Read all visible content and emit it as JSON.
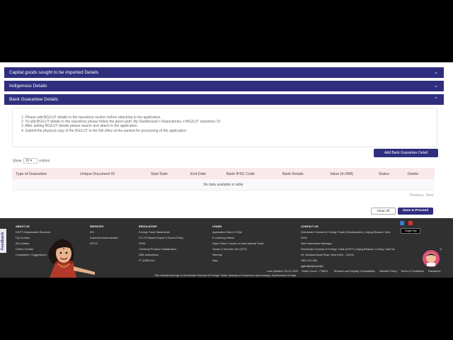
{
  "sections": [
    {
      "title": "Capital goods sought to be imported Details",
      "chevron": "⌄"
    },
    {
      "title": "Indigenous Details",
      "chevron": "⌄"
    },
    {
      "title": "Bank Guarantee Details",
      "chevron": "⌃"
    }
  ],
  "instructions": [
    "1. Please add BG/LUT details in the repository section before attaching to the application.",
    "2. To add BG/LUT details in the repository please follow the given path: My Dashboard>> Repositories >>BG/LUT repository Or",
    "3. After adding BG/LUT details please search and attach in the application.",
    "4. Submit the physical copy of the BG/LUT to the RA office at the earliest for processing of the application."
  ],
  "add_button": "Add Bank Guarantee Detail",
  "show_entries": {
    "prefix": "Show",
    "value": "10",
    "suffix": "entries"
  },
  "table": {
    "columns": [
      "Type of Guarantee",
      "Unique Document ID",
      "Start Date",
      "End Date",
      "Bank IFSC Code",
      "Bank Details",
      "Value (In INR)",
      "Status",
      "Delete"
    ],
    "empty_message": "No data available in table"
  },
  "pagination": {
    "previous": "Previous",
    "next": "Next"
  },
  "actions": {
    "clear": "Clear All",
    "save": "Save & Proceed"
  },
  "feedback": "Feedback",
  "footer": {
    "about": {
      "heading": "ABOUT US",
      "items": [
        "DGFT Organization Structure",
        "HQ Contact",
        "RA Contact",
        "Citizen Charter",
        "Complaints / Suggestions / Fe..."
      ]
    },
    "services": {
      "heading": "SERVICES",
      "items": [
        "IEC",
        "Advanced Authorization",
        "EPCG"
      ]
    },
    "regulatory": {
      "heading": "REGULATORY",
      "items": [
        "Foreign Trade Statements",
        "ITC-HS Based Import & Export Policy",
        "SION",
        "Chemical Product Classification",
        "DBA Instructions",
        "FT (D&R) Act"
      ]
    },
    "learn": {
      "heading": "LEARN",
      "items": [
        "Application Help & FAQs",
        "E-Learning Videos",
        "Open Online Course on International Trade",
        "Goods & Services Tax (GST)",
        "Sitemap",
        "Map"
      ]
    },
    "contact": {
      "heading": "CONTACT US",
      "items": [
        "Directorate General of Foreign Trade (Headquarters), Udyog Bhawan, New",
        "Delhi",
        "Web Information Manager:",
        "Directorate General of Foreign Trade (DGFT) Udyog Bhawan, H-wing, Gate No",
        "02, Maulana Azad Road, New Delhi - 110011",
        "1800-111-550",
        "dgftedi[at]nic[dot]in"
      ]
    },
    "last_updated": "Last Updated: 03-12-2020",
    "visitor_count": "Visitor Count : 776621",
    "links": [
      "Browser and Display Compatibility",
      "Website Policy",
      "Terms & Conditions",
      "Disclaimer"
    ],
    "ownership": "This website belongs to Directorate General of Foreign Trade, Ministry of Commerce and Industry, Government of India",
    "store_badge": "Google Play"
  },
  "colors": {
    "brand": "#2f2e7e",
    "header_row": "#fae8ea",
    "footer": "#303030"
  }
}
